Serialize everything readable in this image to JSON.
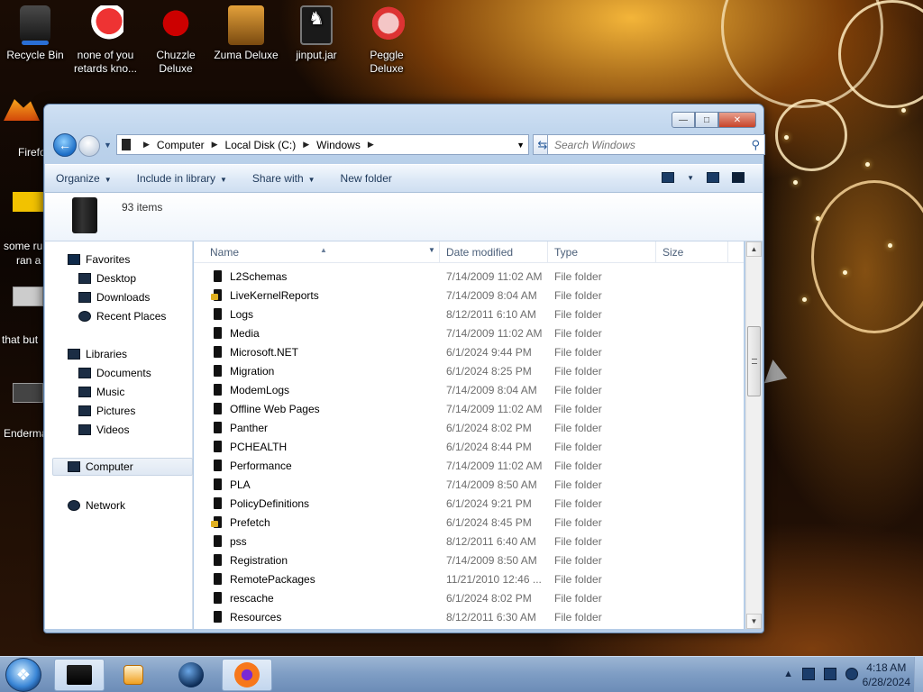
{
  "desktop": {
    "icons": [
      {
        "label": "Recycle Bin",
        "icon": "recycle-bin-icon"
      },
      {
        "label": "none of you retards kno...",
        "icon": "app-icon"
      },
      {
        "label": "Chuzzle Deluxe",
        "icon": "chuzzle-icon"
      },
      {
        "label": "Zuma Deluxe",
        "icon": "zuma-icon"
      },
      {
        "label": "jinput.jar",
        "icon": "jar-file-icon"
      },
      {
        "label": "Peggle Deluxe",
        "icon": "peggle-icon"
      }
    ],
    "left_icons": [
      "Firefo",
      "some ru",
      "ran a",
      "that but",
      "Enderma"
    ]
  },
  "window": {
    "address": {
      "crumbs": [
        "Computer",
        "Local Disk (C:)",
        "Windows"
      ]
    },
    "search": {
      "placeholder": "Search Windows"
    },
    "toolbar": {
      "organize": "Organize",
      "include_in_library": "Include in library",
      "share_with": "Share with",
      "new_folder": "New folder"
    },
    "details": {
      "item_count": "93 items"
    },
    "sidebar": {
      "favorites": "Favorites",
      "favorites_items": [
        "Desktop",
        "Downloads",
        "Recent Places"
      ],
      "libraries": "Libraries",
      "libraries_items": [
        "Documents",
        "Music",
        "Pictures",
        "Videos"
      ],
      "computer": "Computer",
      "network": "Network"
    },
    "columns": {
      "name": "Name",
      "date": "Date modified",
      "type": "Type",
      "size": "Size"
    },
    "files": [
      {
        "name": "L2Schemas",
        "date": "7/14/2009 11:02 AM",
        "type": "File folder",
        "locked": false
      },
      {
        "name": "LiveKernelReports",
        "date": "7/14/2009 8:04 AM",
        "type": "File folder",
        "locked": true
      },
      {
        "name": "Logs",
        "date": "8/12/2011 6:10 AM",
        "type": "File folder",
        "locked": false
      },
      {
        "name": "Media",
        "date": "7/14/2009 11:02 AM",
        "type": "File folder",
        "locked": false
      },
      {
        "name": "Microsoft.NET",
        "date": "6/1/2024 9:44 PM",
        "type": "File folder",
        "locked": false
      },
      {
        "name": "Migration",
        "date": "6/1/2024 8:25 PM",
        "type": "File folder",
        "locked": false
      },
      {
        "name": "ModemLogs",
        "date": "7/14/2009 8:04 AM",
        "type": "File folder",
        "locked": false
      },
      {
        "name": "Offline Web Pages",
        "date": "7/14/2009 11:02 AM",
        "type": "File folder",
        "locked": false
      },
      {
        "name": "Panther",
        "date": "6/1/2024 8:02 PM",
        "type": "File folder",
        "locked": false
      },
      {
        "name": "PCHEALTH",
        "date": "6/1/2024 8:44 PM",
        "type": "File folder",
        "locked": false
      },
      {
        "name": "Performance",
        "date": "7/14/2009 11:02 AM",
        "type": "File folder",
        "locked": false
      },
      {
        "name": "PLA",
        "date": "7/14/2009 8:50 AM",
        "type": "File folder",
        "locked": false
      },
      {
        "name": "PolicyDefinitions",
        "date": "6/1/2024 9:21 PM",
        "type": "File folder",
        "locked": false
      },
      {
        "name": "Prefetch",
        "date": "6/1/2024 8:45 PM",
        "type": "File folder",
        "locked": true
      },
      {
        "name": "pss",
        "date": "8/12/2011 6:40 AM",
        "type": "File folder",
        "locked": false
      },
      {
        "name": "Registration",
        "date": "7/14/2009 8:50 AM",
        "type": "File folder",
        "locked": false
      },
      {
        "name": "RemotePackages",
        "date": "11/21/2010 12:46 ...",
        "type": "File folder",
        "locked": false
      },
      {
        "name": "rescache",
        "date": "6/1/2024 8:02 PM",
        "type": "File folder",
        "locked": false
      },
      {
        "name": "Resources",
        "date": "8/12/2011 6:30 AM",
        "type": "File folder",
        "locked": false
      }
    ]
  },
  "taskbar": {
    "clock_time": "4:18 AM",
    "clock_date": "6/28/2024",
    "pinned": [
      "explorer-icon",
      "media-player-icon",
      "globe-icon",
      "firefox-icon"
    ]
  }
}
